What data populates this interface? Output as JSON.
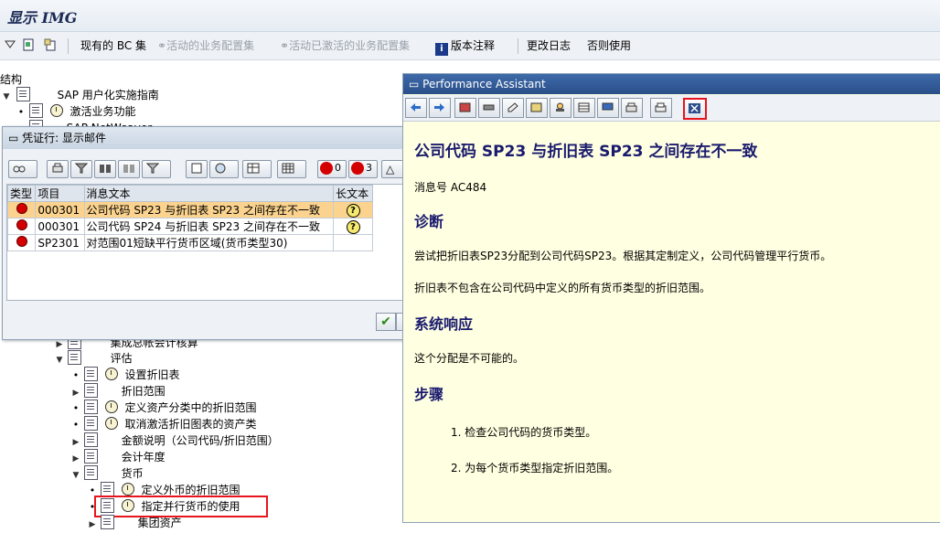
{
  "window": {
    "title": "显示 IMG"
  },
  "app_toolbar": {
    "bc_sets": "现有的 BC 集",
    "activated_bc_sets": "活动的业务配置集",
    "activated_bc_sets_for_activity": "活动已激活的业务配置集",
    "release_notes": "版本注释",
    "change_log": "更改日志",
    "no_use": "否则使用"
  },
  "tree": {
    "header": "结构",
    "items": [
      {
        "label": "SAP 用户化实施指南"
      },
      {
        "label": "激活业务功能"
      },
      {
        "label": "SAP NetWeaver"
      },
      {
        "label": "集成总帐会计核算"
      },
      {
        "label": "评估"
      },
      {
        "label": "设置折旧表"
      },
      {
        "label": "折旧范围"
      },
      {
        "label": "定义资产分类中的折旧范围"
      },
      {
        "label": "取消激活折旧图表的资产类"
      },
      {
        "label": "金额说明（公司代码/折旧范围）"
      },
      {
        "label": "会计年度"
      },
      {
        "label": "货币"
      },
      {
        "label": "定义外币的折旧范围"
      },
      {
        "label": "指定并行货币的使用"
      },
      {
        "label": "集团资产"
      }
    ]
  },
  "msg_dialog": {
    "title": "凭证行: 显示邮件",
    "stop_count": "0",
    "error_count": "3",
    "columns": {
      "type": "类型",
      "item": "项目",
      "text": "消息文本",
      "long_text": "长文本"
    },
    "rows": [
      {
        "item": "000301",
        "text": "公司代码 SP23 与折旧表 SP23 之间存在不一致",
        "help": "?"
      },
      {
        "item": "000301",
        "text": "公司代码 SP24 与折旧表 SP23 之间存在不一致",
        "help": "?"
      },
      {
        "item": "SP2301",
        "text": "对范围01短缺平行货币区域(货币类型30)",
        "help": ""
      }
    ]
  },
  "performance_assistant": {
    "title": "Performance Assistant",
    "heading": "公司代码  SP23 与折旧表  SP23 之间存在不一致",
    "message_no": "消息号  AC484",
    "diagnosis_title": "诊断",
    "diagnosis_p1": "尝试把折旧表SP23分配到公司代码SP23。根据其定制定义，公司代码管理平行货币。",
    "diagnosis_p2": "折旧表不包含在公司代码中定义的所有货币类型的折旧范围。",
    "system_response_title": "系统响应",
    "system_response_p": "这个分配是不可能的。",
    "procedure_title": "步骤",
    "step1": "1. 检查公司代码的货币类型。",
    "step2": "2. 为每个货币类型指定折旧范围。"
  },
  "colors": {
    "highlight_box": "#e8141c",
    "pa_bg": "#ffffe1",
    "heading": "#1a1a6e"
  }
}
